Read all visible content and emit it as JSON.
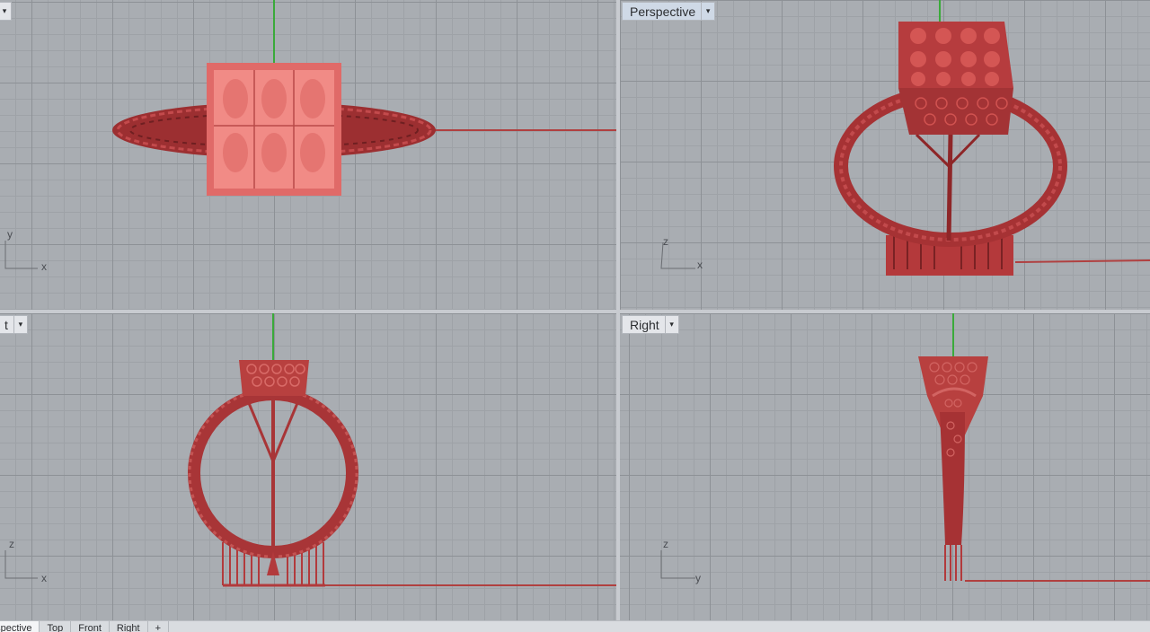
{
  "viewports": {
    "top": {
      "label": "",
      "dropdown": "▾",
      "axis_v": "y",
      "axis_h": "x"
    },
    "perspective": {
      "label": "Perspective",
      "dropdown": "▾",
      "axis_v": "z",
      "axis_h": "x"
    },
    "front": {
      "label": "t",
      "dropdown": "▾",
      "axis_v": "z",
      "axis_h": "x"
    },
    "right": {
      "label": "Right",
      "dropdown": "▾",
      "axis_v": "z",
      "axis_h": "y"
    }
  },
  "bottom_tabs": [
    {
      "label": "Perspective"
    },
    {
      "label": "Top"
    },
    {
      "label": "Front"
    },
    {
      "label": "Right"
    },
    {
      "label": "+"
    }
  ],
  "colors": {
    "model": "#b23a3c",
    "grid_bg": "#a9adb2",
    "x_axis": "#b04040",
    "y_axis": "#3aaa3a"
  }
}
